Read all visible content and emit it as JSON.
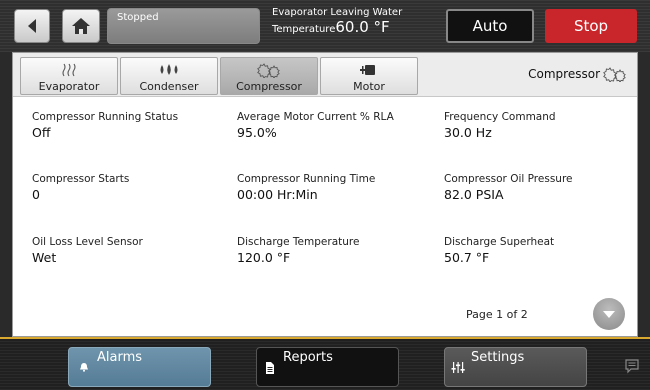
{
  "topbar": {
    "status": "Stopped",
    "evap_label_line1": "Evaporator Leaving Water",
    "evap_label_line2": "Temperature",
    "evap_value": "60.0 °F",
    "auto_label": "Auto",
    "stop_label": "Stop"
  },
  "tabs": [
    {
      "label": "Evaporator",
      "icon": "heat-waves-icon",
      "active": false
    },
    {
      "label": "Condenser",
      "icon": "droplets-icon",
      "active": false
    },
    {
      "label": "Compressor",
      "icon": "compressor-gears-icon",
      "active": true
    },
    {
      "label": "Motor",
      "icon": "motor-icon",
      "active": false
    }
  ],
  "panel_title": "Compressor",
  "fields": [
    {
      "label": "Compressor Running Status",
      "value": "Off"
    },
    {
      "label": "Average Motor Current % RLA",
      "value": "95.0%"
    },
    {
      "label": "Frequency Command",
      "value": "30.0 Hz"
    },
    {
      "label": "Compressor Starts",
      "value": "0"
    },
    {
      "label": "Compressor Running Time",
      "value": "00:00 Hr:Min"
    },
    {
      "label": "Compressor Oil Pressure",
      "value": "82.0 PSIA"
    },
    {
      "label": "Oil Loss Level Sensor",
      "value": "Wet"
    },
    {
      "label": "Discharge Temperature",
      "value": "120.0 °F"
    },
    {
      "label": "Discharge Superheat",
      "value": "50.7 °F"
    }
  ],
  "page_indicator": "Page 1 of 2",
  "bottom_nav": {
    "alarms": "Alarms",
    "reports": "Reports",
    "settings": "Settings"
  },
  "colors": {
    "stop_red": "#c8262b",
    "alarms_blue": "#6f95ad",
    "bottom_accent": "#d8a92e"
  }
}
